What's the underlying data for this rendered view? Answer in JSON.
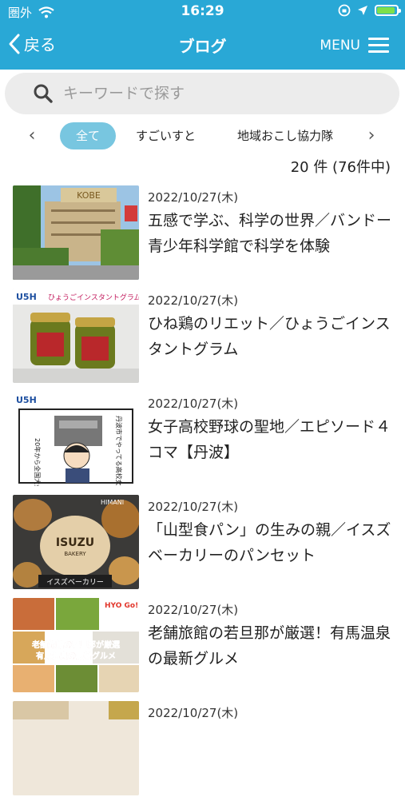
{
  "status": {
    "carrier": "圏外",
    "time": "16:29"
  },
  "header": {
    "back_label": "戻る",
    "title": "ブログ",
    "menu_label": "MENU"
  },
  "search": {
    "placeholder": "キーワードで探す"
  },
  "categories": [
    {
      "label": "全て"
    },
    {
      "label": "すごいすと"
    },
    {
      "label": "地域おこし協力隊"
    }
  ],
  "result_count": "20 件 (76件中)",
  "posts": [
    {
      "date": "2022/10/27(木)",
      "title": "五感で学ぶ、科学の世界／バンドー青少年科学館で科学を体験"
    },
    {
      "date": "2022/10/27(木)",
      "title": "ひね鶏のリエット／ひょうごインスタントグラム"
    },
    {
      "date": "2022/10/27(木)",
      "title": "女子高校野球の聖地／エピソード４コマ【丹波】"
    },
    {
      "date": "2022/10/27(木)",
      "title": "「山型食パン」の生みの親／イスズベーカリーのパンセット"
    },
    {
      "date": "2022/10/27(木)",
      "title": "老舗旅館の若旦那が厳選！有馬温泉の最新グルメ"
    },
    {
      "date": "2022/10/27(木)",
      "title": ""
    }
  ],
  "thumb_text": {
    "t1_sign": "KOBE",
    "t2_logo": "U5H",
    "t2_banner": "ひょうごインスタントグラム",
    "t3_logo": "U5H",
    "t3_text1": "丹波市でやってる高校女子硬式野球",
    "t3_text2": "20年から全国大会の決勝は甲子園で",
    "t4_logo": "HIMANI",
    "t4_brand": "ISUZU",
    "t4_sub": "BAKERY",
    "t4_banner": "イスズベーカリー",
    "t5_logo": "HYO Go!ナビ",
    "t5_text1": "老舗旅館の若旦那が厳選",
    "t5_text2": "有馬温泉の最新グルメ"
  },
  "colors": {
    "header": "#29a8d6",
    "active_tab": "#78c6e0",
    "search_bg": "#ececec"
  }
}
